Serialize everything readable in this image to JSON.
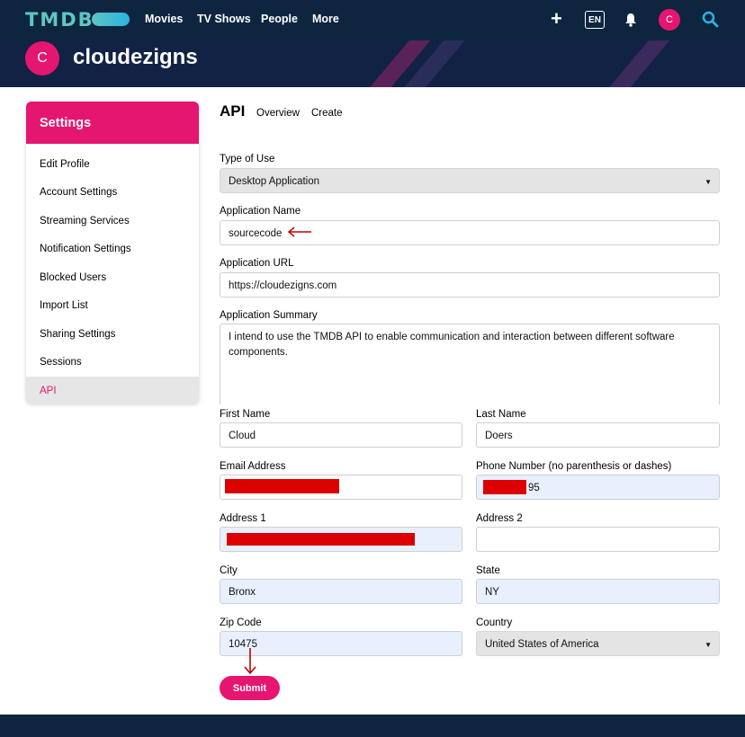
{
  "nav": {
    "logo": "TMDB",
    "links": [
      "Movies",
      "TV Shows",
      "People",
      "More"
    ],
    "language": "EN",
    "avatar_initial": "C"
  },
  "profile": {
    "avatar_initial": "C",
    "username": "cloudezigns"
  },
  "sidebar": {
    "title": "Settings",
    "items": [
      {
        "label": "Edit Profile"
      },
      {
        "label": "Account Settings"
      },
      {
        "label": "Streaming Services"
      },
      {
        "label": "Notification Settings"
      },
      {
        "label": "Blocked Users"
      },
      {
        "label": "Import List"
      },
      {
        "label": "Sharing Settings"
      },
      {
        "label": "Sessions"
      },
      {
        "label": "API",
        "active": true
      }
    ]
  },
  "main": {
    "title": "API",
    "tabs": [
      "Overview",
      "Create"
    ]
  },
  "form": {
    "type_of_use": {
      "label": "Type of Use",
      "value": "Desktop Application"
    },
    "app_name": {
      "label": "Application Name",
      "value": "sourcecode"
    },
    "app_url": {
      "label": "Application URL",
      "value": "https://cloudezigns.com"
    },
    "app_summary": {
      "label": "Application Summary",
      "value": "I intend to use the TMDB API to enable communication and interaction between different software components."
    },
    "first_name": {
      "label": "First Name",
      "value": "Cloud"
    },
    "last_name": {
      "label": "Last Name",
      "value": "Doers"
    },
    "email": {
      "label": "Email Address",
      "value": ""
    },
    "phone": {
      "label": "Phone Number (no parenthesis or dashes)",
      "value": "95"
    },
    "address1": {
      "label": "Address 1",
      "value": ""
    },
    "address2": {
      "label": "Address 2",
      "value": ""
    },
    "city": {
      "label": "City",
      "value": "Bronx"
    },
    "state": {
      "label": "State",
      "value": "NY"
    },
    "zip": {
      "label": "Zip Code",
      "value": "10475"
    },
    "country": {
      "label": "Country",
      "value": "United States of America"
    },
    "submit_label": "Submit"
  },
  "colors": {
    "brand_pink": "#e5166f",
    "navy": "#0d253f",
    "annotation_red": "#c00000"
  }
}
